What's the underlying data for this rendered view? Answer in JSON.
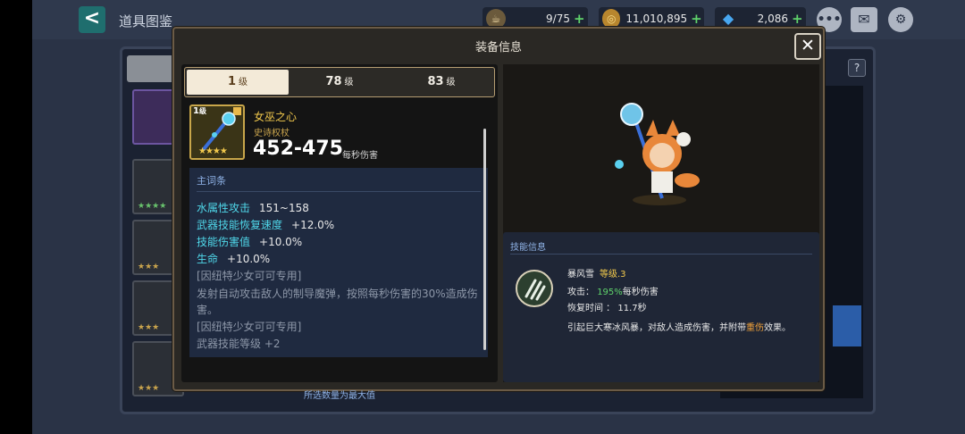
{
  "topbar": {
    "back_label": "<",
    "title": "道具图鉴",
    "stamina": "9/75",
    "gold": "11,010,895",
    "gems": "2,086",
    "plus": "+"
  },
  "background": {
    "help_label": "?"
  },
  "modal": {
    "title": "装备信息",
    "close_label": "✕",
    "tabs": [
      {
        "num": "1",
        "unit": "级"
      },
      {
        "num": "78",
        "unit": "级"
      },
      {
        "num": "83",
        "unit": "级"
      }
    ],
    "item": {
      "level_num": "1",
      "level_unit": "级",
      "stars": "★★★★",
      "name": "女巫之心",
      "type": "史诗权杖",
      "damage": "452-475",
      "damage_unit": "每秒伤害"
    },
    "stats": {
      "header": "主词条",
      "rows": [
        {
          "key": "水属性攻击",
          "value": "151~158"
        },
        {
          "key": "武器技能恢复速度",
          "value": "+12.0%"
        },
        {
          "key": "技能伤害值",
          "value": "+10.0%"
        },
        {
          "key": "生命",
          "value": "+10.0%"
        }
      ],
      "desc": [
        "[因纽特少女可可专用]",
        "发射自动攻击敌人的制导魔弹，按照每秒伤害的30%造成伤",
        "害。",
        "[因纽特少女可可专用]",
        "武器技能等级 +2"
      ],
      "footer": "所选数量为最大值"
    },
    "skill": {
      "header": "技能信息",
      "name": "暴风雪",
      "level": "等级.3",
      "atk_label": "攻击：",
      "atk_value": "195%",
      "atk_unit": "每秒伤害",
      "cd": "恢复时间 ： 11.7秒",
      "desc_a": "引起巨大寒冰风暴，对敌人造成伤害，并附带",
      "desc_b": "重伤",
      "desc_c": "效果。"
    }
  },
  "colors": {
    "accent_gold": "#f2c94c",
    "stat_cyan": "#4fd7e9",
    "green": "#5fd36b"
  }
}
